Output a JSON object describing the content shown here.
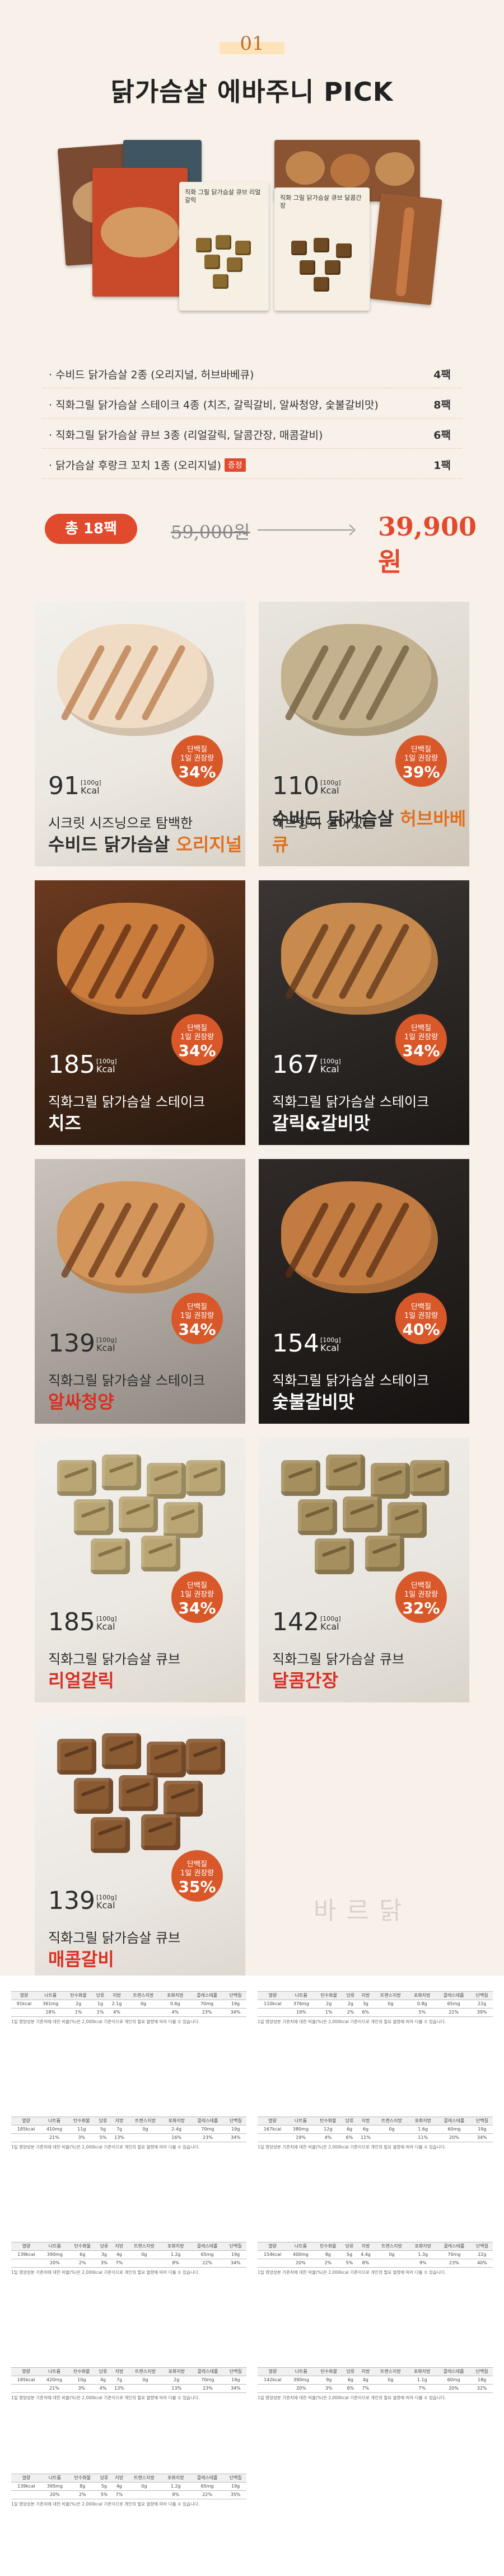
{
  "header": {
    "number": "01",
    "title": "닭가슴살 에바주니 PICK"
  },
  "product_image": {
    "labels": [
      "직화 그릴 닭가슴살 큐브 리얼갈릭",
      "직화 그릴 닭가슴살 큐브 달콤간장"
    ]
  },
  "composition": [
    {
      "text": "수비드 닭가슴살 2종 (오리지널, 허브바베큐)",
      "qty": "4팩",
      "gift": ""
    },
    {
      "text": "직화그릴 닭가슴살 스테이크 4종 (치즈, 갈릭갈비, 알싸청양, 숯불갈비맛)",
      "qty": "8팩",
      "gift": ""
    },
    {
      "text": "직화그릴 닭가슴살 큐브 3종 (리얼갈릭, 달콤간장, 매콤갈비)",
      "qty": "6팩",
      "gift": ""
    },
    {
      "text": "닭가슴살 후랑크 꼬치 1종 (오리지널)",
      "qty": "1팩",
      "gift": "증정"
    }
  ],
  "price": {
    "total": "총 18팩",
    "original": "59,000원",
    "sale": "39,900원"
  },
  "products": [
    {
      "kcal": "91",
      "unit_top": "[100g]",
      "unit": "Kcal",
      "badge_top": "단백질\n1일 권장량",
      "badge_pct": "34%",
      "line1": "시크릿 시즈닝으로 탐백한",
      "line2a": "수비드 닭가슴살 ",
      "line2b": "오리지널",
      "theme": "light",
      "badge_color": "#d8582a"
    },
    {
      "kcal": "110",
      "unit_top": "[100g]",
      "unit": "Kcal",
      "badge_top": "단백질\n1일 권장량",
      "badge_pct": "39%",
      "line1": "허브향이 살아있는",
      "line2a": "수비드 닭가슴살 ",
      "line2b": "허브바베큐",
      "theme": "light",
      "badge_color": "#d8582a"
    },
    {
      "kcal": "185",
      "unit_top": "[100g]",
      "unit": "Kcal",
      "badge_top": "단백질\n1일 권장량",
      "badge_pct": "34%",
      "line1": "직화그릴 닭가슴살 스테이크",
      "line2a": "치즈",
      "line2b": "",
      "theme": "dark",
      "badge_color": "#d8582a"
    },
    {
      "kcal": "167",
      "unit_top": "[100g]",
      "unit": "Kcal",
      "badge_top": "단백질\n1일 권장량",
      "badge_pct": "34%",
      "line1": "직화그릴 닭가슴살 스테이크",
      "line2a": "갈릭&갈비맛",
      "line2b": "",
      "theme": "dark",
      "badge_color": "#d8582a"
    },
    {
      "kcal": "139",
      "unit_top": "[100g]",
      "unit": "Kcal",
      "badge_top": "단백질\n1일 권장량",
      "badge_pct": "34%",
      "line1": "직화그릴 닭가슴살 스테이크",
      "line2a": "알싸청양",
      "line2b": "",
      "theme": "light",
      "badge_color": "#d8582a"
    },
    {
      "kcal": "154",
      "unit_top": "[100g]",
      "unit": "Kcal",
      "badge_top": "단백질\n1일 권장량",
      "badge_pct": "40%",
      "line1": "직화그릴 닭가슴살 스테이크",
      "line2a": "숯불갈비맛",
      "line2b": "",
      "theme": "dark",
      "badge_color": "#d8582a"
    },
    {
      "kcal": "185",
      "unit_top": "[100g]",
      "unit": "Kcal",
      "badge_top": "단백질\n1일 권장량",
      "badge_pct": "34%",
      "line1": "직화그릴 닭가슴살 큐브",
      "line2a": "리얼갈릭",
      "line2b": "",
      "theme": "light",
      "badge_color": "#d8582a"
    },
    {
      "kcal": "142",
      "unit_top": "[100g]",
      "unit": "Kcal",
      "badge_top": "단백질\n1일 권장량",
      "badge_pct": "32%",
      "line1": "직화그릴 닭가슴살 큐브",
      "line2a": "달콤간장",
      "line2b": "",
      "theme": "light",
      "badge_color": "#d8582a"
    },
    {
      "kcal": "139",
      "unit_top": "[100g]",
      "unit": "Kcal",
      "badge_top": "단백질\n1일 권장량",
      "badge_pct": "35%",
      "line1": "직화그릴 닭가슴살 큐브",
      "line2a": "매콤갈비",
      "line2b": "",
      "theme": "light",
      "badge_color": "#d8582a"
    }
  ],
  "watermark": "바르닭",
  "nutrition": {
    "headers": [
      "열량",
      "나트륨",
      "탄수화물",
      "당류",
      "지방",
      "트랜스지방",
      "포화지방",
      "콜레스테롤",
      "단백질"
    ],
    "notes": "1일 영양성분 기준치에 대한 비율(%)은 2,000kcal 기준이므로 개인의 필요 열량에 따라 다를 수 있습니다.",
    "tables": [
      {
        "row1": [
          "91kcal",
          "361mg",
          "2g",
          "1g",
          "2.1g",
          "0g",
          "0.6g",
          "70mg",
          "19g"
        ],
        "row2": [
          "",
          "18%",
          "1%",
          "1%",
          "4%",
          "",
          "4%",
          "23%",
          "34%"
        ]
      },
      {
        "row1": [
          "110kcal",
          "376mg",
          "2g",
          "2g",
          "3g",
          "0g",
          "0.8g",
          "65mg",
          "22g"
        ],
        "row2": [
          "",
          "19%",
          "1%",
          "2%",
          "6%",
          "",
          "5%",
          "22%",
          "39%"
        ]
      },
      {
        "row1": [
          "185kcal",
          "410mg",
          "11g",
          "5g",
          "7g",
          "0g",
          "2.4g",
          "70mg",
          "19g"
        ],
        "row2": [
          "",
          "21%",
          "3%",
          "5%",
          "13%",
          "",
          "16%",
          "23%",
          "34%"
        ]
      },
      {
        "row1": [
          "167kcal",
          "380mg",
          "12g",
          "6g",
          "6g",
          "0g",
          "1.6g",
          "60mg",
          "19g"
        ],
        "row2": [
          "",
          "19%",
          "4%",
          "6%",
          "11%",
          "",
          "11%",
          "20%",
          "34%"
        ]
      },
      {
        "row1": [
          "139kcal",
          "390mg",
          "6g",
          "3g",
          "4g",
          "0g",
          "1.2g",
          "65mg",
          "19g"
        ],
        "row2": [
          "",
          "20%",
          "2%",
          "3%",
          "7%",
          "",
          "8%",
          "22%",
          "34%"
        ]
      },
      {
        "row1": [
          "154kcal",
          "400mg",
          "8g",
          "5g",
          "4.4g",
          "0g",
          "1.3g",
          "70mg",
          "22g"
        ],
        "row2": [
          "",
          "20%",
          "2%",
          "5%",
          "8%",
          "",
          "9%",
          "23%",
          "40%"
        ]
      },
      {
        "row1": [
          "185kcal",
          "420mg",
          "10g",
          "4g",
          "7g",
          "0g",
          "2g",
          "70mg",
          "19g"
        ],
        "row2": [
          "",
          "21%",
          "3%",
          "4%",
          "13%",
          "",
          "13%",
          "23%",
          "34%"
        ]
      },
      {
        "row1": [
          "142kcal",
          "390mg",
          "9g",
          "6g",
          "4g",
          "0g",
          "1.1g",
          "60mg",
          "18g"
        ],
        "row2": [
          "",
          "20%",
          "3%",
          "6%",
          "7%",
          "",
          "7%",
          "20%",
          "32%"
        ]
      },
      {
        "row1": [
          "139kcal",
          "395mg",
          "8g",
          "5g",
          "4g",
          "0g",
          "1.2g",
          "65mg",
          "19g"
        ],
        "row2": [
          "",
          "20%",
          "2%",
          "5%",
          "7%",
          "",
          "8%",
          "22%",
          "35%"
        ]
      }
    ]
  }
}
